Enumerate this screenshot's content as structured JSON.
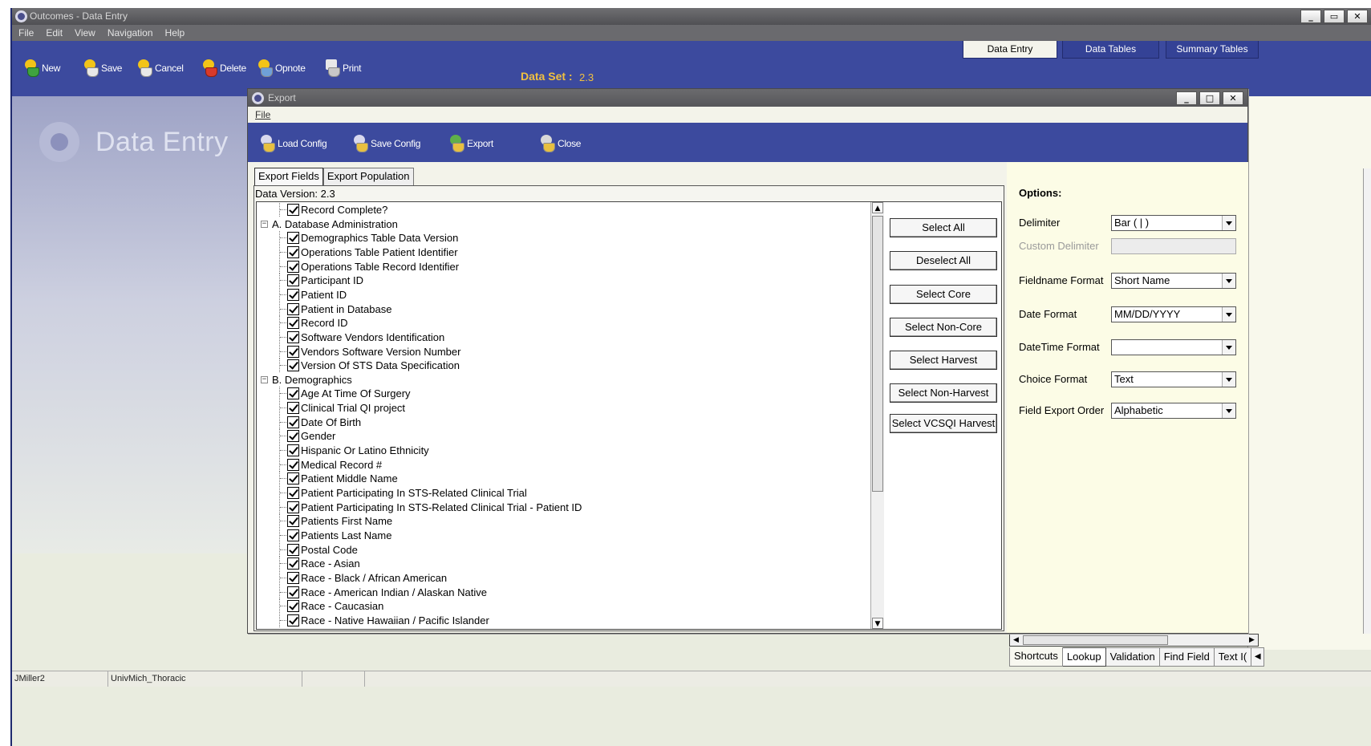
{
  "main_window": {
    "title": "Outcomes - Data Entry",
    "menu": [
      "File",
      "Edit",
      "View",
      "Navigation",
      "Help"
    ],
    "toolbar": {
      "new": "New",
      "save": "Save",
      "cancel": "Cancel",
      "delete": "Delete",
      "opnote": "Opnote",
      "print": "Print"
    },
    "dataset_label": "Data Set :",
    "dataset_value": "2.3",
    "tabs": [
      "Data Entry",
      "Data Tables",
      "Summary Tables"
    ],
    "panel_title": "Data Entry",
    "bottom_tabs": [
      "Shortcuts",
      "Lookup",
      "Validation",
      "Find Field",
      "Text I("
    ],
    "status": {
      "user": "JMiller2",
      "site": "UnivMich_Thoracic"
    }
  },
  "export_dialog": {
    "title": "Export",
    "menu": "File",
    "toolbar": {
      "load_config": "Load Config",
      "save_config": "Save Config",
      "export": "Export",
      "close": "Close"
    },
    "tabs": [
      "Export Fields",
      "Export Population"
    ],
    "version_label": "Data Version: 2.3",
    "tree": [
      {
        "type": "item",
        "label": "Record Complete?"
      },
      {
        "type": "group",
        "label": "A. Database Administration"
      },
      {
        "type": "item",
        "label": "Demographics Table Data Version"
      },
      {
        "type": "item",
        "label": "Operations Table Patient Identifier"
      },
      {
        "type": "item",
        "label": "Operations Table Record Identifier"
      },
      {
        "type": "item",
        "label": "Participant ID"
      },
      {
        "type": "item",
        "label": "Patient ID"
      },
      {
        "type": "item",
        "label": "Patient in Database"
      },
      {
        "type": "item",
        "label": "Record ID"
      },
      {
        "type": "item",
        "label": "Software Vendors Identification"
      },
      {
        "type": "item",
        "label": "Vendors Software Version Number"
      },
      {
        "type": "item",
        "label": "Version Of STS Data Specification"
      },
      {
        "type": "group",
        "label": "B. Demographics"
      },
      {
        "type": "item",
        "label": "Age At Time Of Surgery"
      },
      {
        "type": "item",
        "label": "Clinical Trial QI project"
      },
      {
        "type": "item",
        "label": "Date Of Birth"
      },
      {
        "type": "item",
        "label": "Gender"
      },
      {
        "type": "item",
        "label": "Hispanic Or Latino Ethnicity"
      },
      {
        "type": "item",
        "label": "Medical Record #"
      },
      {
        "type": "item",
        "label": "Patient Middle Name"
      },
      {
        "type": "item",
        "label": "Patient Participating In STS-Related Clinical Trial"
      },
      {
        "type": "item",
        "label": "Patient Participating In STS-Related Clinical Trial - Patient ID"
      },
      {
        "type": "item",
        "label": "Patients First Name"
      },
      {
        "type": "item",
        "label": "Patients Last Name"
      },
      {
        "type": "item",
        "label": "Postal Code"
      },
      {
        "type": "item",
        "label": "Race -  Asian"
      },
      {
        "type": "item",
        "label": "Race -  Black / African American"
      },
      {
        "type": "item",
        "label": "Race - American Indian / Alaskan Native"
      },
      {
        "type": "item",
        "label": "Race - Caucasian"
      },
      {
        "type": "item",
        "label": "Race - Native Hawaiian / Pacific Islander"
      }
    ],
    "select_buttons": [
      "Select All",
      "Deselect All",
      "Select Core",
      "Select Non-Core",
      "Select Harvest",
      "Select Non-Harvest",
      "Select VCSQI Harvest"
    ],
    "options": {
      "title": "Options:",
      "fields": [
        {
          "label": "Delimiter",
          "value": "Bar ( | )",
          "enabled": true
        },
        {
          "label": "Custom Delimiter",
          "value": "",
          "enabled": false
        },
        {
          "label": "Fieldname Format",
          "value": "Short Name",
          "enabled": true
        },
        {
          "label": "Date Format",
          "value": "MM/DD/YYYY",
          "enabled": true
        },
        {
          "label": "DateTime Format",
          "value": "",
          "enabled": true
        },
        {
          "label": "Choice Format",
          "value": "Text",
          "enabled": true
        },
        {
          "label": "Field Export Order",
          "value": "Alphabetic",
          "enabled": true
        }
      ]
    }
  }
}
